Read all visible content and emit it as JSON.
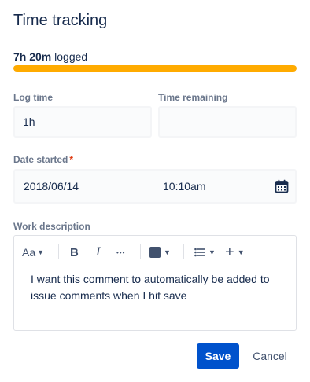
{
  "dialog": {
    "title": "Time tracking"
  },
  "tracking": {
    "logged_amount": "7h 20m",
    "logged_suffix": "logged",
    "progress_fraction": 1.0,
    "bar_color": "#ffab00"
  },
  "log_time": {
    "label": "Log time",
    "value": "1h"
  },
  "time_remaining": {
    "label": "Time remaining",
    "value": ""
  },
  "date_started": {
    "label": "Date started",
    "required_marker": "*",
    "date": "2018/06/14",
    "time": "10:10am"
  },
  "work_description": {
    "label": "Work description",
    "toolbar": {
      "text_style": "Aa",
      "bold": "B",
      "italic": "I",
      "more": "•••",
      "add": "+"
    },
    "text": "I want this comment to automatically be added to issue comments when I hit save"
  },
  "actions": {
    "save_label": "Save",
    "cancel_label": "Cancel"
  },
  "colors": {
    "primary": "#0052cc",
    "text": "#172b4d",
    "subtle": "#6b778c",
    "required": "#de350b"
  }
}
